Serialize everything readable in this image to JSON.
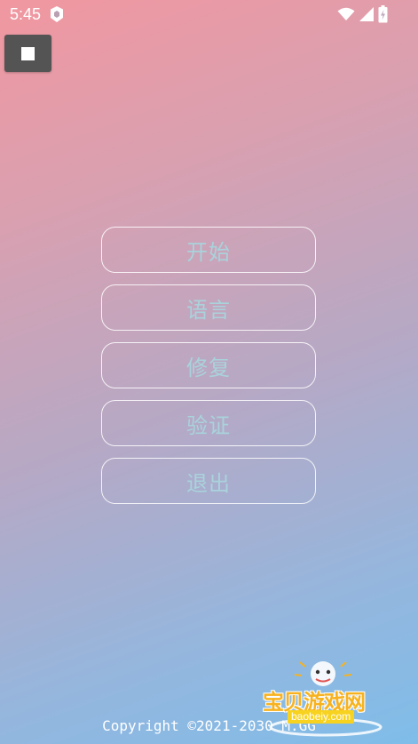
{
  "status_bar": {
    "time": "5:45",
    "icons": [
      "app-notification-icon",
      "wifi-icon",
      "cellular-signal-icon",
      "battery-charging-icon"
    ]
  },
  "toolbar": {
    "stop_button_icon": "stop-square-icon"
  },
  "menu": {
    "items": [
      {
        "label": "开始"
      },
      {
        "label": "语言"
      },
      {
        "label": "修复"
      },
      {
        "label": "验证"
      },
      {
        "label": "退出"
      }
    ]
  },
  "footer": {
    "copyright": "Copyright ©2021-2030 M.GG"
  },
  "watermark": {
    "title": "宝贝游戏网",
    "domain": "baobeiy.com"
  },
  "colors": {
    "gradient_top": "#f197a0",
    "gradient_bottom": "#7fbde9",
    "menu_text": "#a9d3dc",
    "menu_border": "#ffffff",
    "stop_button_bg": "#545454",
    "watermark_accent": "#f7b21f"
  }
}
